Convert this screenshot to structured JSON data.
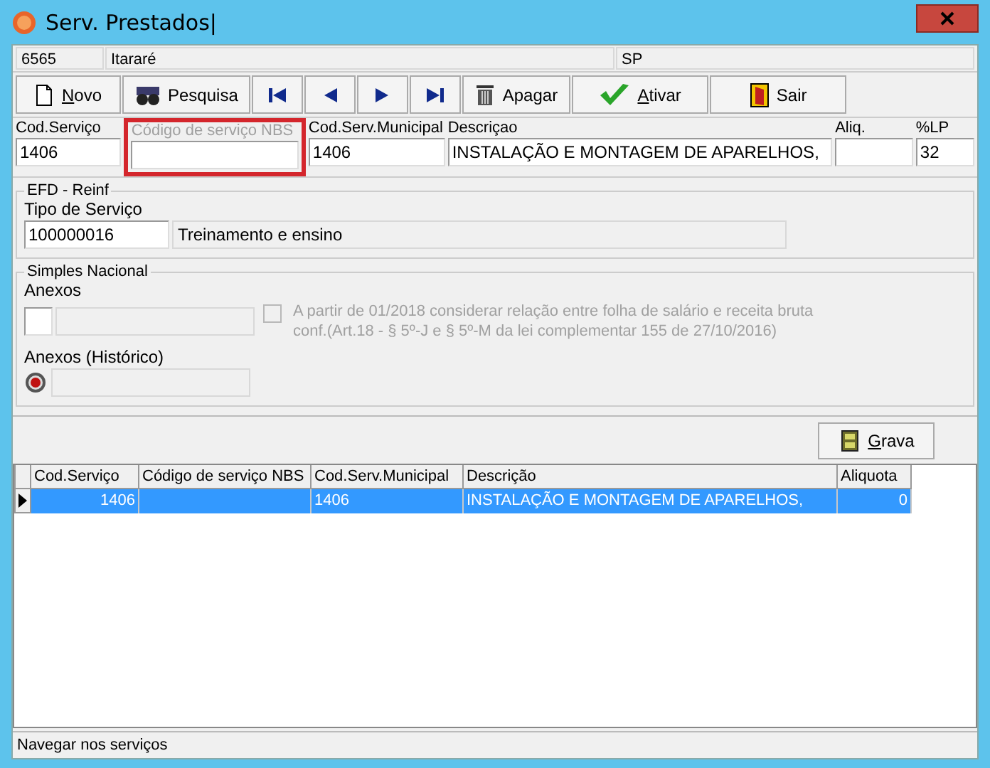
{
  "window": {
    "title": "Serv. Prestados|"
  },
  "header": {
    "code": "6565",
    "city": "Itararé",
    "state": "SP"
  },
  "toolbar": [
    {
      "kind": "new",
      "label": "Novo"
    },
    {
      "kind": "search",
      "label": "Pesquisa"
    },
    {
      "kind": "first"
    },
    {
      "kind": "prev"
    },
    {
      "kind": "next"
    },
    {
      "kind": "last"
    },
    {
      "kind": "delete",
      "label": "Apagar"
    },
    {
      "kind": "activate",
      "label": "Ativar"
    },
    {
      "kind": "exit",
      "label": "Sair"
    }
  ],
  "fields": [
    {
      "label": "Cod.Serviço",
      "value": "1406",
      "disabled": false,
      "highlighted": false
    },
    {
      "label": "Código de serviço NBS",
      "disabled": true,
      "highlighted": true
    },
    {
      "label": "Cod.Serv.Municipal",
      "value": "1406",
      "disabled": false,
      "highlighted": false
    },
    {
      "label": "Descriçao",
      "value": "INSTALAÇÃO E MONTAGEM DE APARELHOS,",
      "disabled": false,
      "highlighted": false
    },
    {
      "label": "Aliq.",
      "disabled": false,
      "highlighted": false
    },
    {
      "label": "%LP",
      "value": "32",
      "disabled": false,
      "highlighted": false
    }
  ],
  "efd_reinf": {
    "title": "EFD - Reinf",
    "label": "Tipo de Serviço",
    "code": "100000016",
    "description": "Treinamento e ensino"
  },
  "simples_nacional": {
    "title": "Simples Nacional",
    "anexos_label": "Anexos",
    "checkbox": {
      "checked": false,
      "disabled": true,
      "label_lines": [
        "A partir de 01/2018 considerar relação entre folha de salário e receita bruta",
        "conf.(Art.18 - § 5º-J e § 5º-M da lei complementar 155 de 27/10/2016)"
      ]
    },
    "historico_label": "Anexos (Histórico)"
  },
  "save_button": {
    "label": "Grava"
  },
  "table": {
    "columns": [
      "Cod.Serviço",
      "Código de serviço NBS",
      "Cod.Serv.Municipal",
      "Descrição",
      "Aliquota"
    ],
    "rows": [
      {
        "selected": true,
        "cells": [
          "1406",
          "",
          "1406",
          "INSTALAÇÃO E MONTAGEM DE APARELHOS,",
          "0"
        ]
      }
    ]
  },
  "status_bar": "Navegar nos serviços"
}
